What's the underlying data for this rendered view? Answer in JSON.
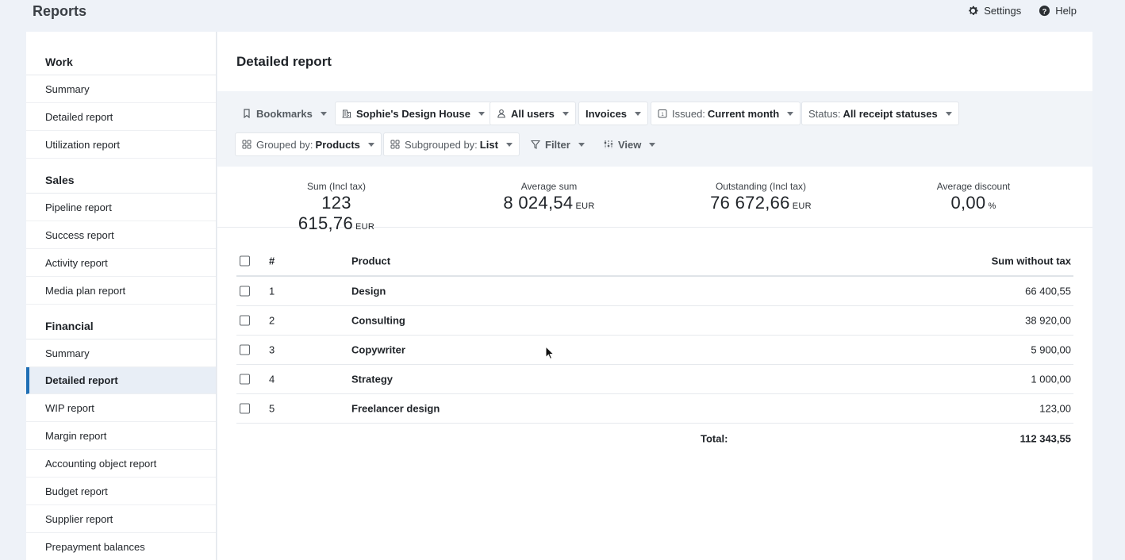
{
  "app": {
    "title": "Reports"
  },
  "top_actions": {
    "settings": "Settings",
    "help": "Help"
  },
  "sidebar": {
    "sections": [
      {
        "title": "Work",
        "items": [
          "Summary",
          "Detailed report",
          "Utilization report"
        ]
      },
      {
        "title": "Sales",
        "items": [
          "Pipeline report",
          "Success report",
          "Activity report",
          "Media plan report"
        ]
      },
      {
        "title": "Financial",
        "items": [
          "Summary",
          "Detailed report",
          "WIP report",
          "Margin report",
          "Accounting object report",
          "Budget report",
          "Supplier report",
          "Prepayment balances"
        ]
      }
    ],
    "active": "Financial / Detailed report"
  },
  "main": {
    "title": "Detailed report",
    "filters": {
      "bookmarks": "Bookmarks",
      "company": "Sophie's Design House",
      "users": "All users",
      "type": "Invoices",
      "issued_label": "Issued:",
      "issued_value": "Current month",
      "status_label": "Status:",
      "status_value": "All receipt statuses",
      "grouped_label": "Grouped by:",
      "grouped_value": "Products",
      "subgrouped_label": "Subgrouped by:",
      "subgrouped_value": "List",
      "filter": "Filter",
      "view": "View"
    },
    "kpis": {
      "sum_label": "Sum (Incl tax)",
      "sum_value": "123 615,76",
      "sum_unit": "EUR",
      "avg_label": "Average sum",
      "avg_value": "8 024,54",
      "avg_unit": "EUR",
      "out_label": "Outstanding (Incl tax)",
      "out_value": "76 672,66",
      "out_unit": "EUR",
      "disc_label": "Average discount",
      "disc_value": "0,00",
      "disc_unit": "%"
    },
    "table": {
      "headers": {
        "num": "#",
        "product": "Product",
        "sum": "Sum without tax"
      },
      "rows": [
        {
          "num": "1",
          "product": "Design",
          "sum": "66 400,55"
        },
        {
          "num": "2",
          "product": "Consulting",
          "sum": "38 920,00"
        },
        {
          "num": "3",
          "product": "Copywriter",
          "sum": "5 900,00"
        },
        {
          "num": "4",
          "product": "Strategy",
          "sum": "1 000,00"
        },
        {
          "num": "5",
          "product": "Freelancer design",
          "sum": "123,00"
        }
      ],
      "total_label": "Total:",
      "total_value": "112 343,55"
    }
  },
  "colors": {
    "accent": "#1f6fb5",
    "background": "#eef2f8",
    "filterbar": "#f1f4f8"
  }
}
